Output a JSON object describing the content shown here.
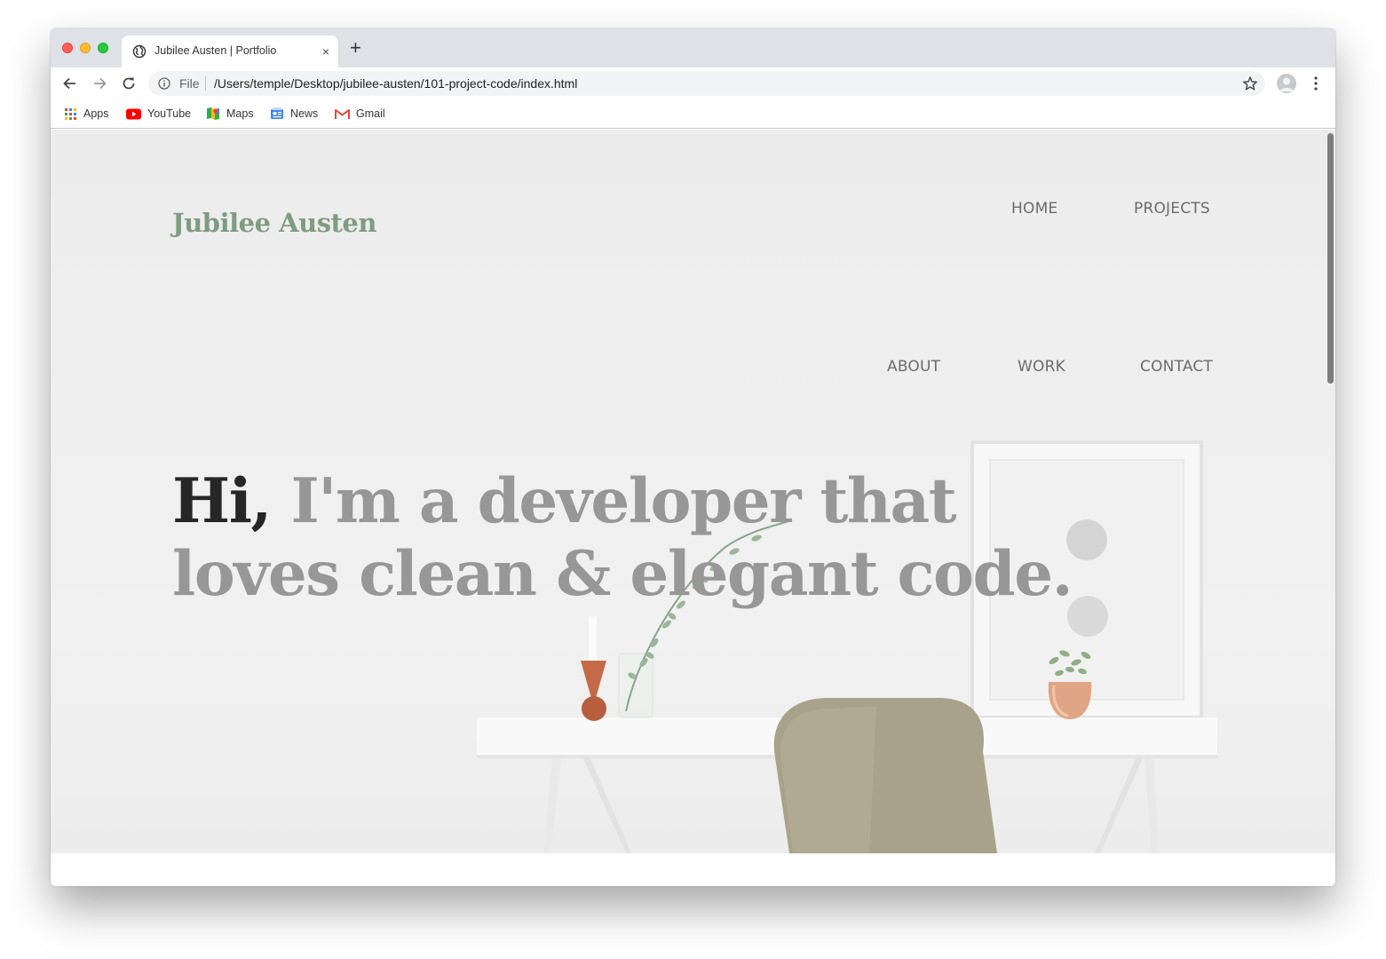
{
  "browser": {
    "tab": {
      "title": "Jubilee Austen | Portfolio",
      "close": "×"
    },
    "new_tab": "+",
    "omnibox": {
      "scheme": "File",
      "url": "/Users/temple/Desktop/jubilee-austen/101-project-code/index.html"
    },
    "bookmarks": [
      {
        "label": "Apps",
        "icon": "apps-grid-icon"
      },
      {
        "label": "YouTube",
        "icon": "youtube-icon"
      },
      {
        "label": "Maps",
        "icon": "maps-icon"
      },
      {
        "label": "News",
        "icon": "news-icon"
      },
      {
        "label": "Gmail",
        "icon": "gmail-icon"
      }
    ]
  },
  "site": {
    "logo": "Jubilee Austen",
    "nav": {
      "home": "HOME",
      "projects": "PROJECTS",
      "about": "ABOUT",
      "work": "WORK",
      "contact": "CONTACT"
    },
    "hero": {
      "greeting": "Hi",
      "comma": ",",
      "tagline": " I'm a developer that loves clean & elegant code."
    }
  },
  "colors": {
    "logo": "#7f9c80",
    "nav_text": "#6b6b6b",
    "headline_muted": "#979797",
    "headline_dark": "#262626",
    "tab_strip": "#dee1e6"
  }
}
